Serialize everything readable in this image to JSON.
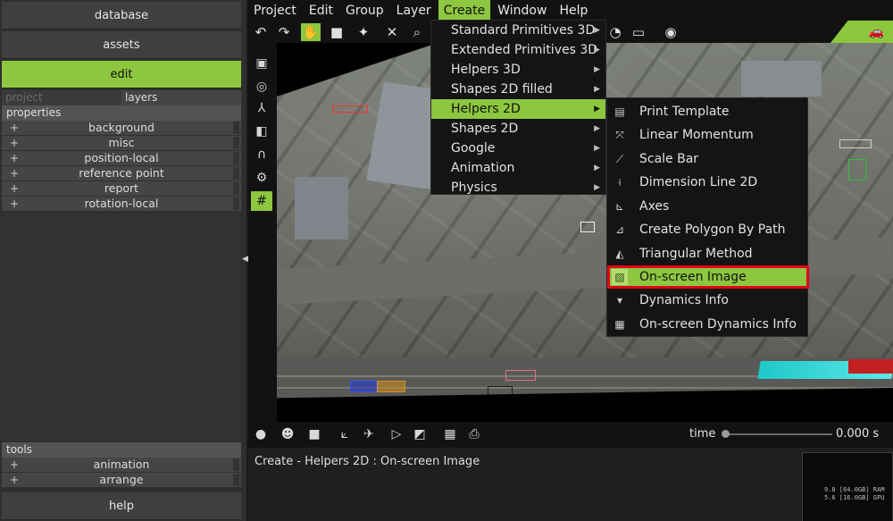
{
  "left_panel": {
    "database_label": "database",
    "assets_label": "assets",
    "edit_label": "edit",
    "tabs": {
      "project": "project",
      "layers": "layers"
    },
    "properties_header": "properties",
    "properties": [
      "background",
      "misc",
      "position-local",
      "reference point",
      "report",
      "rotation-local"
    ],
    "tools_header": "tools",
    "tools": [
      "animation",
      "arrange"
    ],
    "help_label": "help",
    "plus": "+"
  },
  "menubar": {
    "items": [
      "Project",
      "Edit",
      "Group",
      "Layer",
      "Create",
      "Window",
      "Help"
    ],
    "open_item": "Create"
  },
  "create_menu": {
    "items": [
      {
        "label": "Standard Primitives 3D",
        "submenu": true
      },
      {
        "label": "Extended Primitives 3D",
        "submenu": true
      },
      {
        "label": "Helpers 3D",
        "submenu": true
      },
      {
        "label": "Shapes 2D filled",
        "submenu": true
      },
      {
        "label": "Helpers 2D",
        "submenu": true,
        "highlighted": true
      },
      {
        "label": "Shapes 2D",
        "submenu": true
      },
      {
        "label": "Google",
        "submenu": true
      },
      {
        "label": "Animation",
        "submenu": true
      },
      {
        "label": "Physics",
        "submenu": true
      }
    ]
  },
  "helpers2d_menu": {
    "items": [
      {
        "label": "Print Template",
        "icon": "print-template-icon"
      },
      {
        "label": "Linear Momentum",
        "icon": "linear-momentum-icon"
      },
      {
        "label": "Scale Bar",
        "icon": "scale-bar-icon"
      },
      {
        "label": "Dimension Line 2D",
        "icon": "dimension-line-icon"
      },
      {
        "label": "Axes",
        "icon": "axes-icon"
      },
      {
        "label": "Create Polygon By Path",
        "icon": "polygon-path-icon"
      },
      {
        "label": "Triangular Method",
        "icon": "triangular-method-icon"
      },
      {
        "label": "On-screen Image",
        "icon": "onscreen-image-icon",
        "highlighted": true
      },
      {
        "label": "Dynamics Info",
        "icon": "dynamics-info-icon"
      },
      {
        "label": "On-screen Dynamics Info",
        "icon": "onscreen-dynamics-info-icon"
      }
    ]
  },
  "timeline": {
    "label": "time",
    "value": "0.000 s"
  },
  "status": {
    "text": "Create - Helpers 2D : On-screen Image"
  },
  "mini_panel": {
    "lines": [
      "9.8 [64.0GB] RAM",
      "5.6 [16.0GB] GPU"
    ]
  },
  "colors": {
    "accent": "#8dc63f",
    "highlight_border": "#e2001a"
  }
}
